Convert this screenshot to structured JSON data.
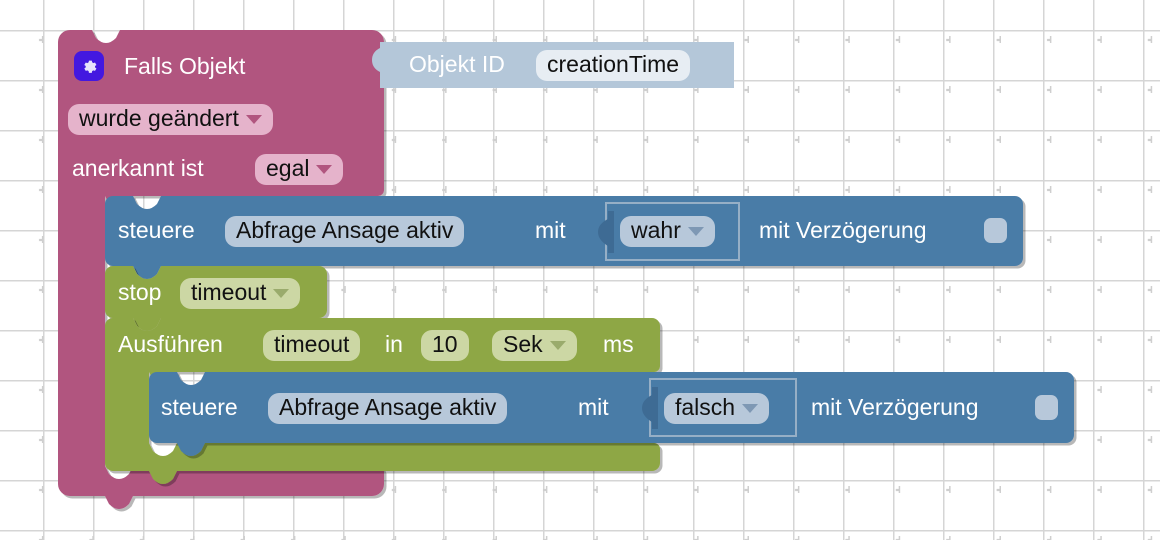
{
  "app": {
    "kind": "blockly-workspace",
    "language": "de",
    "background_color": "#ffffff",
    "grid_marker": "plus"
  },
  "palette": {
    "event_block": "#b1557f",
    "event_block_field": "#e5b3cb",
    "value_block": "#b4c7d9",
    "action_block": "#4a7ba7",
    "action_block_field": "#b7c8da",
    "timer_block": "#8ea744",
    "timer_block_field": "#ccd7a4",
    "mutator_button": "#4318e0",
    "text_light": "#ffffff",
    "text_dark": "#111111"
  },
  "blocks": {
    "event": {
      "name": "falls-objekt",
      "mutator_icon": "gear-icon",
      "title": "Falls Objekt",
      "trigger_dropdown": "wurde geändert",
      "ack_label": "anerkannt ist",
      "ack_dropdown": "egal",
      "value_input": {
        "name": "objekt-id",
        "label": "Objekt ID",
        "value": "creationTime"
      }
    },
    "statements": [
      {
        "name": "steuere-wahr",
        "type": "action",
        "label_1": "steuere",
        "object_field": "Abfrage Ansage aktiv",
        "label_2": "mit",
        "value_dropdown": "wahr",
        "delay_label": "mit Verzögerung",
        "delay_checked": false
      },
      {
        "name": "stop-timeout",
        "type": "timer",
        "label_1": "stop",
        "timer_dropdown": "timeout"
      },
      {
        "name": "ausfuehren-timeout",
        "type": "timer",
        "label_1": "Ausführen",
        "timer_field": "timeout",
        "label_2": "in",
        "delay_value": "10",
        "unit_dropdown": "Sek",
        "label_3": "ms",
        "body": [
          {
            "name": "steuere-falsch",
            "type": "action",
            "label_1": "steuere",
            "object_field": "Abfrage Ansage aktiv",
            "label_2": "mit",
            "value_dropdown": "falsch",
            "delay_label": "mit Verzögerung",
            "delay_checked": false
          }
        ]
      }
    ]
  }
}
